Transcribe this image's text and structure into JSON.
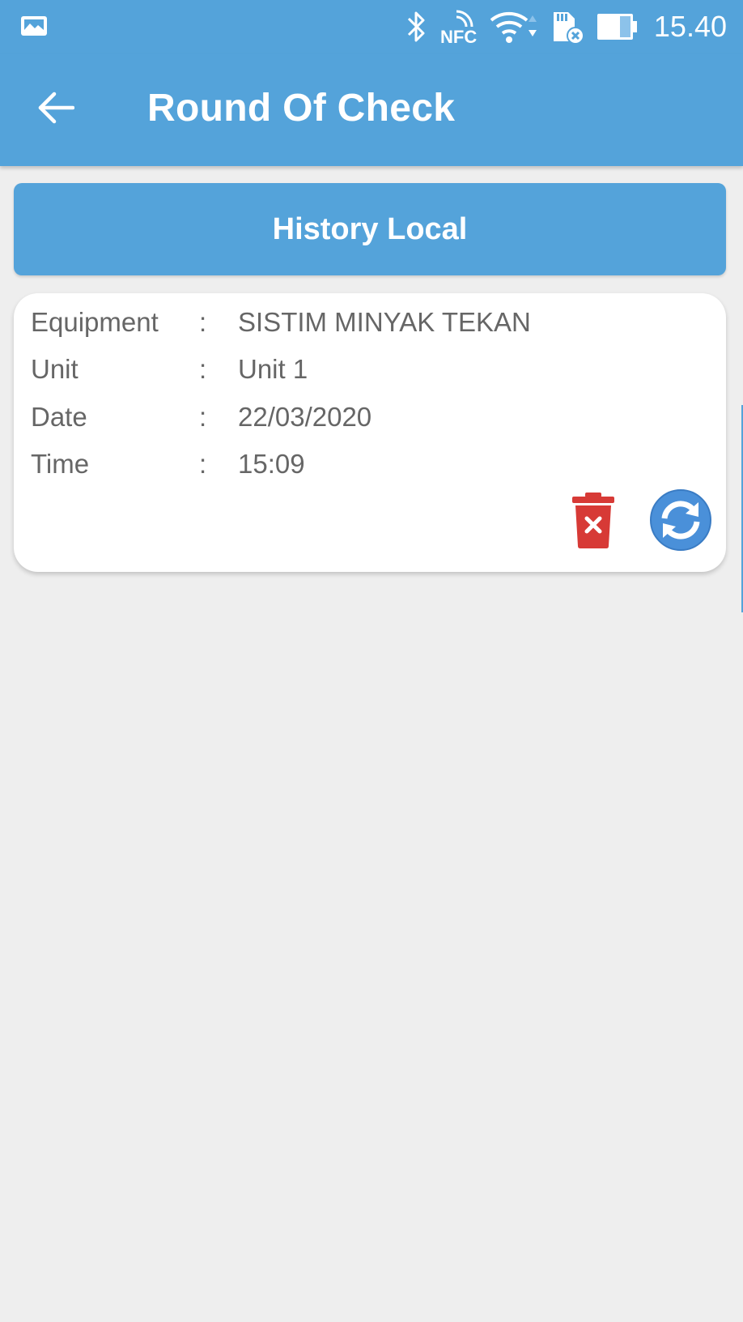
{
  "status_bar": {
    "time": "15.40",
    "icons": [
      "gallery-icon",
      "bluetooth-icon",
      "nfc-icon",
      "wifi-icon",
      "sd-card-icon",
      "battery-icon"
    ],
    "nfc_label": "NFC"
  },
  "app_bar": {
    "title": "Round Of Check",
    "back_icon": "arrow-left-icon"
  },
  "history_button": {
    "label": "History Local"
  },
  "records": [
    {
      "fields": [
        {
          "label": "Equipment",
          "separator": ":",
          "value": "SISTIM MINYAK TEKAN"
        },
        {
          "label": "Unit",
          "separator": ":",
          "value": "Unit 1"
        },
        {
          "label": "Date",
          "separator": ":",
          "value": "22/03/2020"
        },
        {
          "label": "Time",
          "separator": ":",
          "value": "15:09"
        }
      ],
      "actions": [
        "delete-icon",
        "sync-icon"
      ]
    }
  ],
  "colors": {
    "primary": "#54a3da",
    "background": "#eeeeee",
    "card": "#ffffff",
    "text_secondary": "#666666",
    "delete_red": "#d73a36"
  }
}
